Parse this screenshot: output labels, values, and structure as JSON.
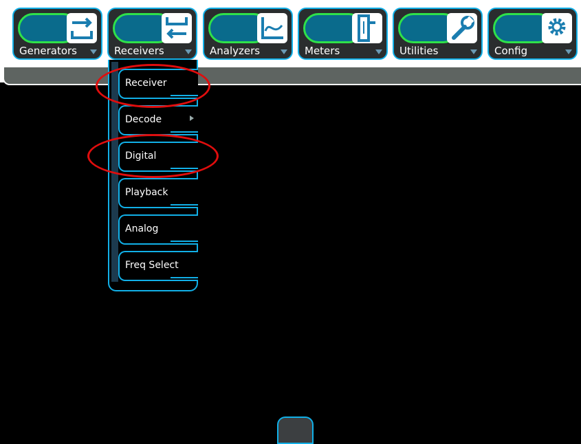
{
  "tabs": [
    {
      "label": "Generators",
      "icon": "generator-icon"
    },
    {
      "label": "Receivers",
      "icon": "receiver-icon"
    },
    {
      "label": "Analyzers",
      "icon": "analyzer-icon"
    },
    {
      "label": "Meters",
      "icon": "meter-icon"
    },
    {
      "label": "Utilities",
      "icon": "wrench-icon"
    },
    {
      "label": "Config",
      "icon": "gear-icon"
    }
  ],
  "receivers_menu": {
    "items": [
      {
        "label": "Receiver"
      },
      {
        "label": "Decode"
      },
      {
        "label": "Digital"
      },
      {
        "label": "Playback"
      },
      {
        "label": "Analog"
      },
      {
        "label": "Freq Select"
      }
    ]
  },
  "colors": {
    "accent": "#11b0e8",
    "pill_border": "#2fe14a",
    "highlight": "#e00d0d",
    "strip": "#5e6461"
  }
}
